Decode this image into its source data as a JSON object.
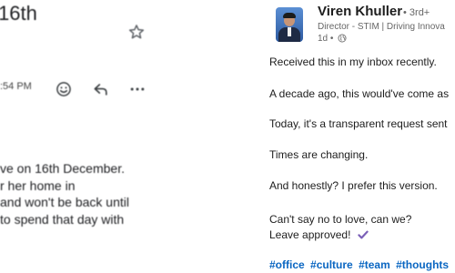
{
  "email": {
    "subject": "16th",
    "time": ":54 PM",
    "icons": [
      "star-icon",
      "emoji-icon",
      "reply-icon",
      "more-icon"
    ],
    "body_lines": [
      "ve on 16th December.",
      "r her home in",
      "and won't be back until",
      "to spend that day with"
    ]
  },
  "post": {
    "author": "Viren Khuller",
    "degree": "• 3rd+",
    "headline": "Director - STIM | Driving Innova",
    "time_ago": "1d •",
    "lines": [
      "Received this in my inbox recently.",
      "A decade ago, this would've come as",
      "Today, it's a transparent request sent",
      "Times are changing.",
      "And honestly? I prefer this version.",
      "Can't say no to love, can we?",
      "Leave approved!"
    ],
    "hashtags": [
      "#office",
      "#culture",
      "#team",
      "#thoughts"
    ],
    "accent_color": "#0a66c2",
    "check_color": "#7a5fb7"
  }
}
